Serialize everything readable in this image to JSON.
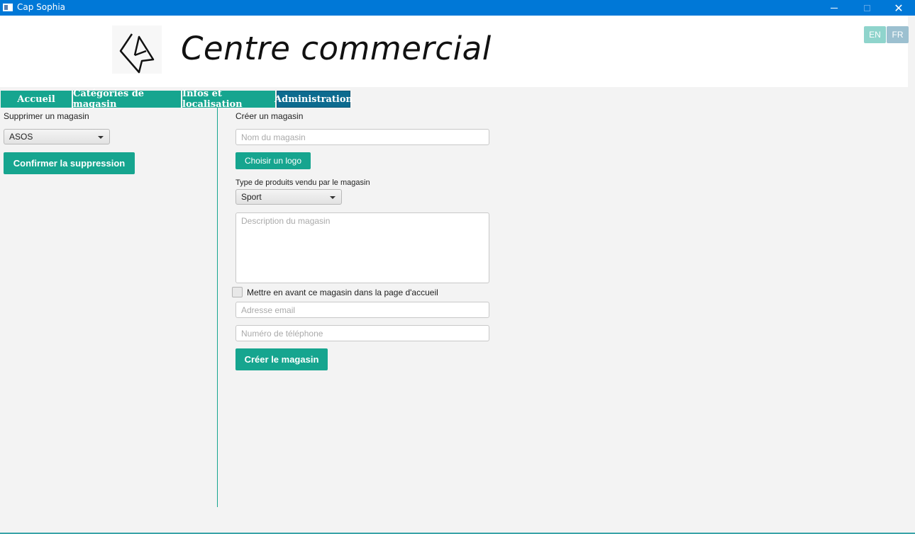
{
  "window": {
    "title": "Cap Sophia",
    "close_glyph": "✕"
  },
  "header": {
    "app_title": "Centre commercial",
    "languages": [
      "EN",
      "FR"
    ]
  },
  "tabs": [
    {
      "label": "Accueil",
      "active": false
    },
    {
      "label": "Catégories de magasin",
      "active": false
    },
    {
      "label": "Infos et localisation",
      "active": false
    },
    {
      "label": "Administration",
      "active": true
    }
  ],
  "delete_section": {
    "title": "Supprimer un magasin",
    "selected_store": "ASOS",
    "confirm_label": "Confirmer la suppression"
  },
  "create_section": {
    "title": "Créer un magasin",
    "name_placeholder": "Nom du magasin",
    "logo_button": "Choisir un logo",
    "product_type_label": "Type de produits vendu par le magasin",
    "product_type_value": "Sport",
    "description_placeholder": "Description du magasin",
    "feature_checkbox_label": "Mettre en avant ce magasin dans la page d'accueil",
    "feature_checked": false,
    "email_placeholder": "Adresse email",
    "phone_placeholder": "Numéro de téléphone",
    "create_button": "Créer le magasin"
  },
  "colors": {
    "titlebar": "#0078d7",
    "accent_green": "#16a58f",
    "active_tab": "#0d6b8f"
  }
}
